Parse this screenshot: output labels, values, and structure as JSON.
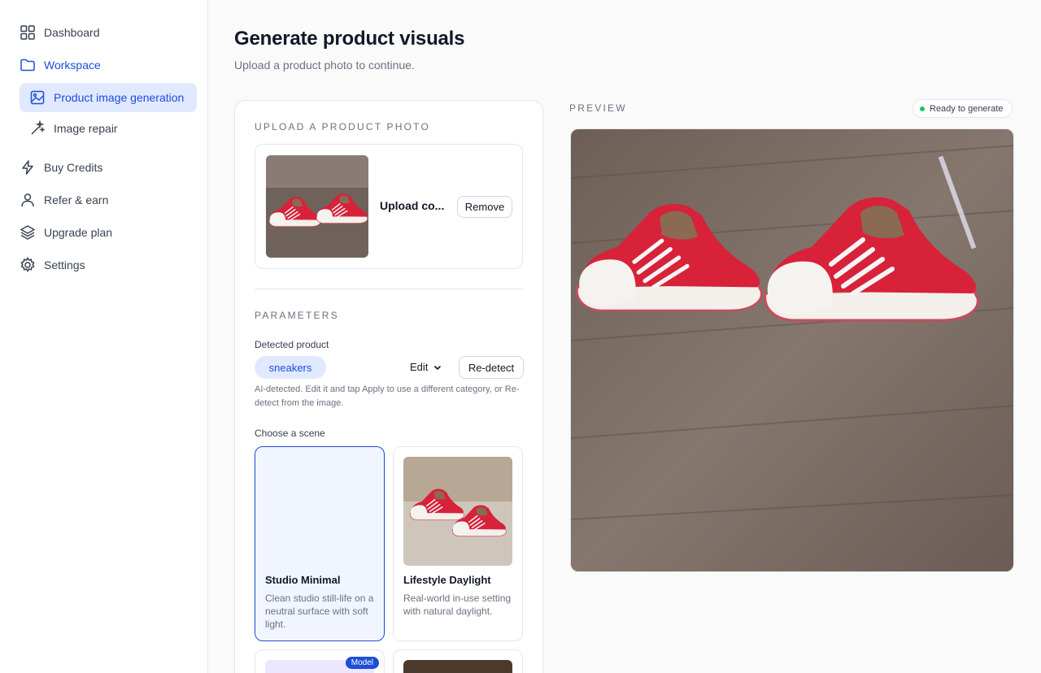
{
  "sidebar": {
    "items": [
      {
        "label": "Dashboard",
        "icon": "grid-icon"
      },
      {
        "label": "Workspace",
        "icon": "folder-icon"
      },
      {
        "label": "Product image generation",
        "icon": "image-icon"
      },
      {
        "label": "Image repair",
        "icon": "magic-wand-icon"
      },
      {
        "label": "Buy Credits",
        "icon": "lightning-icon"
      },
      {
        "label": "Refer & earn",
        "icon": "user-icon"
      },
      {
        "label": "Upgrade plan",
        "icon": "layers-icon"
      },
      {
        "label": "Settings",
        "icon": "gear-icon"
      }
    ]
  },
  "page": {
    "title": "Generate product visuals",
    "subtitle": "Upload a product photo to continue."
  },
  "upload": {
    "section_label": "UPLOAD A PRODUCT PHOTO",
    "file_name": "Upload co...",
    "remove_label": "Remove"
  },
  "parameters": {
    "section_label": "PARAMETERS",
    "detected_label": "Detected product",
    "detected_value": "sneakers",
    "edit_label": "Edit",
    "redetect_label": "Re-detect",
    "hint": "AI-detected. Edit it and tap Apply to use a different category, or Re-detect from the image.",
    "scene_label": "Choose a scene"
  },
  "scenes": [
    {
      "title": "Studio Minimal",
      "desc": "Clean studio still-life on a neutral surface with soft light.",
      "selected": true
    },
    {
      "title": "Lifestyle Daylight",
      "desc": "Real-world in-use setting with natural daylight.",
      "selected": false
    }
  ],
  "model_badge": "Model",
  "preview": {
    "label": "PREVIEW",
    "status": "Ready to generate"
  },
  "colors": {
    "accent": "#1d4ed8",
    "accent_soft": "#e0e9ff",
    "status_green": "#22c55e",
    "shoe_red": "#d7223a"
  }
}
